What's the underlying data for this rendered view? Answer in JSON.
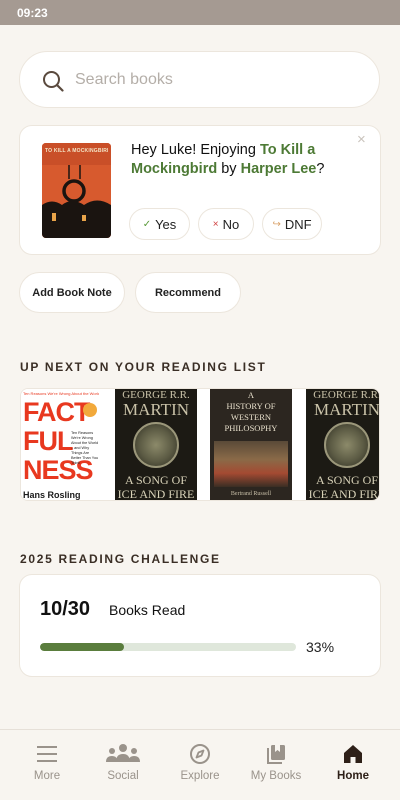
{
  "status_bar": {
    "time": "09:23"
  },
  "search": {
    "placeholder": "Search books",
    "value": ""
  },
  "current_book": {
    "greeting": "Hey Luke! Enjoying",
    "title": "To Kill a Mockingbird",
    "by": "by",
    "author": "Harper Lee",
    "question_mark": "?",
    "cover_text": "TO KILL A MOCKINGBIRD",
    "responses": [
      {
        "glyph": "✓",
        "label": "Yes",
        "color": "#5a9a3a"
      },
      {
        "glyph": "×",
        "label": "No",
        "color": "#d04040"
      },
      {
        "glyph": "↪",
        "label": "DNF",
        "color": "#d9a26a"
      }
    ]
  },
  "actions": {
    "add_note": "Add Book Note",
    "recommend": "Recommend"
  },
  "reading_list": {
    "title": "UP NEXT ON YOUR READING LIST",
    "books": [
      {
        "top_text": "Ten Reasons We're Wrong About the World",
        "title_lines": [
          "FACT",
          "FUL",
          "NESS"
        ],
        "author": "Hans Rosling",
        "tagline": "Ten Reasons We're Wrong About the World – and Why Things Are Better Than You Think"
      },
      {
        "author": "GEORGE R.R.",
        "author2": "MARTIN",
        "title_a": "A SONG OF",
        "title_b": "ICE AND FIRE"
      },
      {
        "title_lines": [
          "A",
          "HISTORY OF",
          "WESTERN",
          "PHILOSOPHY"
        ],
        "author": "Bertrand Russell"
      },
      {
        "author": "GEORGE R.R.",
        "author2": "MARTIN",
        "title_a": "A SONG OF",
        "title_b": "ICE AND FIRE"
      }
    ]
  },
  "challenge": {
    "title": "2025 READING CHALLENGE",
    "count": "10/30",
    "label": "Books Read",
    "progress": 0.33,
    "percent_label": "33%"
  },
  "tabs": [
    {
      "icon": "menu-icon",
      "label": "More",
      "active": false
    },
    {
      "icon": "people-icon",
      "label": "Social",
      "active": false
    },
    {
      "icon": "compass-icon",
      "label": "Explore",
      "active": false
    },
    {
      "icon": "books-icon",
      "label": "My Books",
      "active": false
    },
    {
      "icon": "home-icon",
      "label": "Home",
      "active": true
    }
  ],
  "colors": {
    "accent": "#4d7a35",
    "progress": "#5a7d3d",
    "background": "#f8f5f0",
    "status_bar": "#a59a92"
  }
}
